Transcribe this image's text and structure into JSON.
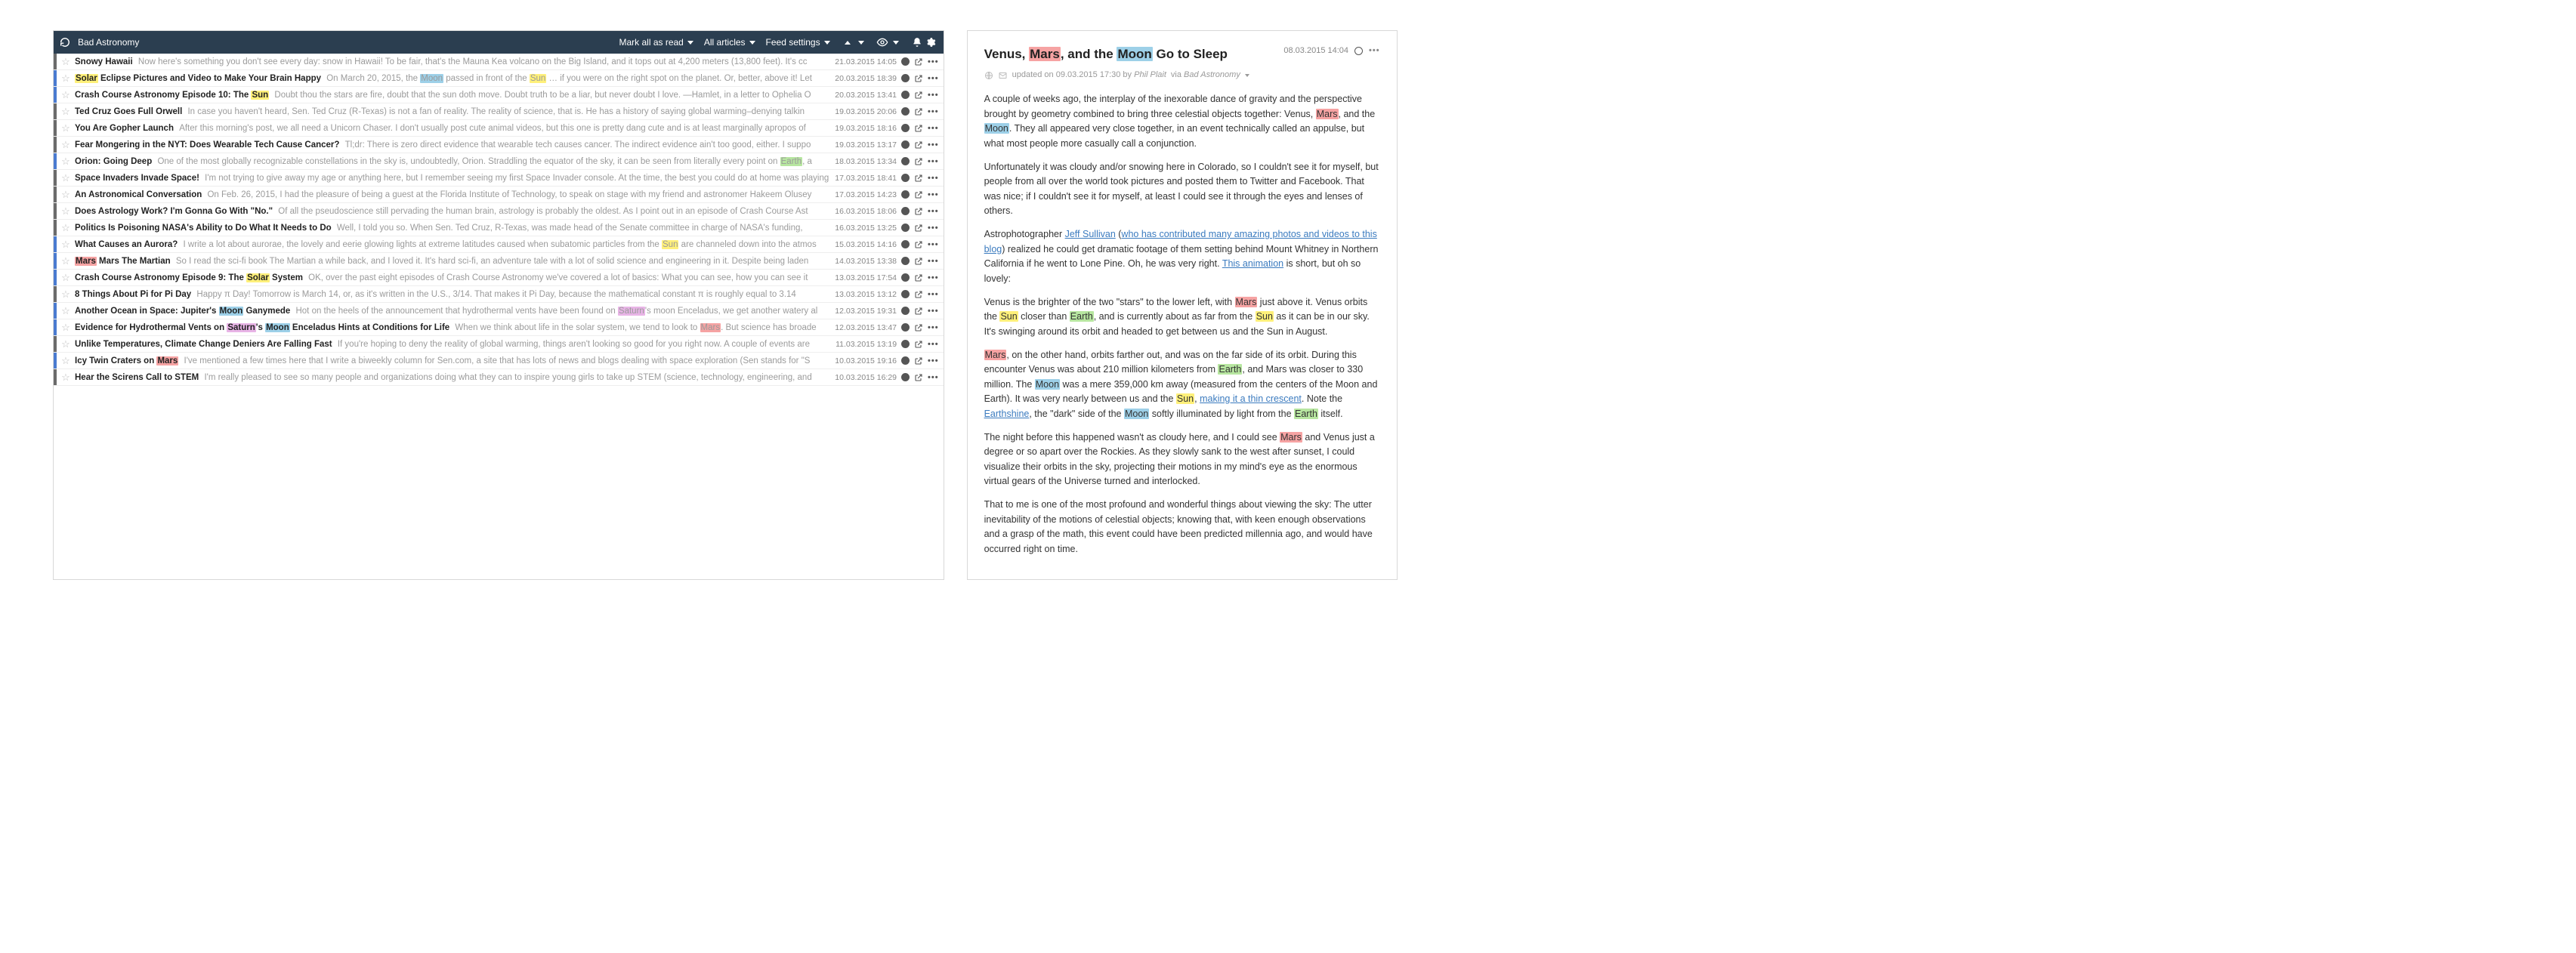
{
  "colors": {
    "accent_default": "#6b6b6b",
    "accent_active": "#4a7bd0",
    "mars": "#f6a3a3",
    "moon": "#9dd0e8",
    "sun": "#fff07a",
    "earth": "#b7e6a0",
    "saturn": "#e8b4e6"
  },
  "topbar": {
    "feed_title": "Bad Astronomy",
    "mark_all": "Mark all as read",
    "all_articles": "All articles",
    "feed_settings": "Feed settings"
  },
  "articles": [
    {
      "accent": "default",
      "unread": true,
      "title_segments": [
        {
          "t": "Snowy Hawaii"
        }
      ],
      "snippet": "Now here's something you don't see every day: snow in Hawaii! To be fair, that's the Mauna Kea volcano on the Big Island, and it tops out at 4,200 meters (13,800 feet). It's cc",
      "date": "21.03.2015 14:05"
    },
    {
      "accent": "active",
      "unread": true,
      "title_segments": [
        {
          "t": "Solar",
          "hl": "solar"
        },
        {
          "t": " Eclipse Pictures and Video to Make Your Brain Happy"
        }
      ],
      "snippet_segments": [
        {
          "t": "On March 20, 2015, the "
        },
        {
          "t": "Moon",
          "hl": "moon"
        },
        {
          "t": " passed in front of the "
        },
        {
          "t": "Sun",
          "hl": "sun"
        },
        {
          "t": " … if you were on the right spot on the planet. Or, better, above it! Let"
        }
      ],
      "date": "20.03.2015 18:39"
    },
    {
      "accent": "active",
      "unread": true,
      "title_segments": [
        {
          "t": "Crash Course Astronomy Episode 10: The "
        },
        {
          "t": "Sun",
          "hl": "sun"
        }
      ],
      "snippet": "Doubt thou the stars are fire, doubt that the sun doth move. Doubt truth to be a liar, but never doubt I love. —Hamlet, in a letter to Ophelia O",
      "date": "20.03.2015 13:41"
    },
    {
      "accent": "default",
      "unread": true,
      "title_segments": [
        {
          "t": "Ted Cruz Goes Full Orwell"
        }
      ],
      "snippet": "In case you haven't heard, Sen. Ted Cruz (R-Texas) is not a fan of reality. The reality of science, that is. He has a history of saying global warming–denying talkin",
      "date": "19.03.2015 20:06"
    },
    {
      "accent": "default",
      "unread": true,
      "title_segments": [
        {
          "t": "You Are Gopher Launch"
        }
      ],
      "snippet": "After this morning's post, we all need a Unicorn Chaser. I don't usually post cute animal videos, but this one is pretty dang cute and is at least marginally apropos of",
      "date": "19.03.2015 18:16"
    },
    {
      "accent": "default",
      "unread": true,
      "title_segments": [
        {
          "t": "Fear Mongering in the NYT: Does Wearable Tech Cause Cancer?"
        }
      ],
      "snippet": "Tl;dr: There is zero direct evidence that wearable tech causes cancer. The indirect evidence ain't too good, either. I suppo",
      "date": "19.03.2015 13:17"
    },
    {
      "accent": "active",
      "unread": true,
      "title_segments": [
        {
          "t": "Orion: Going Deep"
        }
      ],
      "snippet_segments": [
        {
          "t": "One of the most globally recognizable constellations in the sky is, undoubtedly, Orion. Straddling the equator of the sky, it can be seen from literally every point on "
        },
        {
          "t": "Earth",
          "hl": "earth"
        },
        {
          "t": ", a"
        }
      ],
      "date": "18.03.2015 13:34"
    },
    {
      "accent": "default",
      "unread": true,
      "title_segments": [
        {
          "t": "Space Invaders Invade Space!"
        }
      ],
      "snippet": "I'm not trying to give away my age or anything here, but I remember seeing my first Space Invader console. At the time, the best you could do at home was playing",
      "date": "17.03.2015 18:41"
    },
    {
      "accent": "default",
      "unread": true,
      "title_segments": [
        {
          "t": "An Astronomical Conversation"
        }
      ],
      "snippet": "On Feb. 26, 2015, I had the pleasure of being a guest at the Florida Institute of Technology, to speak on stage with my friend and astronomer Hakeem Olusey",
      "date": "17.03.2015 14:23"
    },
    {
      "accent": "default",
      "unread": true,
      "title_segments": [
        {
          "t": "Does Astrology Work? I'm Gonna Go With \"No.\""
        }
      ],
      "snippet": "Of all the pseudoscience still pervading the human brain, astrology is probably the oldest. As I point out in an episode of Crash Course Ast",
      "date": "16.03.2015 18:06"
    },
    {
      "accent": "default",
      "unread": true,
      "title_segments": [
        {
          "t": "Politics Is Poisoning NASA's Ability to Do What It Needs to Do"
        }
      ],
      "snippet": "Well, I told you so. When Sen. Ted Cruz, R-Texas, was made head of the Senate committee in charge of NASA's funding,",
      "date": "16.03.2015 13:25"
    },
    {
      "accent": "active",
      "unread": true,
      "title_segments": [
        {
          "t": "What Causes an Aurora?"
        }
      ],
      "snippet_segments": [
        {
          "t": "I write a lot about aurorae, the lovely and eerie glowing lights at extreme latitudes caused when subatomic particles from the "
        },
        {
          "t": "Sun",
          "hl": "sun"
        },
        {
          "t": " are channeled down into the atmos"
        }
      ],
      "date": "15.03.2015 14:16"
    },
    {
      "accent": "active",
      "unread": true,
      "title_segments": [
        {
          "t": "Mars",
          "hl": "mars"
        },
        {
          "t": " Mars The Martian"
        }
      ],
      "snippet": "So I read the sci-fi book The Martian a while back, and I loved it. It's hard sci-fi, an adventure tale with a lot of solid science and engineering in it. Despite being laden",
      "date": "14.03.2015 13:38"
    },
    {
      "accent": "active",
      "unread": true,
      "title_segments": [
        {
          "t": "Crash Course Astronomy Episode 9: The "
        },
        {
          "t": "Solar",
          "hl": "solar"
        },
        {
          "t": " System"
        }
      ],
      "snippet": "OK, over the past eight episodes of Crash Course Astronomy we've covered a lot of basics: What you can see, how you can see it",
      "date": "13.03.2015 17:54"
    },
    {
      "accent": "default",
      "unread": true,
      "title_segments": [
        {
          "t": "8 Things About Pi for Pi Day"
        }
      ],
      "snippet": "Happy π Day! Tomorrow is March 14, or, as it's written in the U.S., 3/14. That makes it Pi Day, because the mathematical constant π is roughly equal to 3.14",
      "date": "13.03.2015 13:12"
    },
    {
      "accent": "active",
      "unread": true,
      "title_segments": [
        {
          "t": "Another Ocean in Space: Jupiter's "
        },
        {
          "t": "Moon",
          "hl": "moon"
        },
        {
          "t": " Ganymede"
        }
      ],
      "snippet_segments": [
        {
          "t": "Hot on the heels of the announcement that hydrothermal vents have been found on "
        },
        {
          "t": "Saturn",
          "hl": "saturn"
        },
        {
          "t": "'s moon Enceladus, we get another watery al"
        }
      ],
      "date": "12.03.2015 19:31"
    },
    {
      "accent": "active",
      "unread": true,
      "title_segments": [
        {
          "t": "Evidence for Hydrothermal Vents on "
        },
        {
          "t": "Saturn",
          "hl": "saturn"
        },
        {
          "t": "'s "
        },
        {
          "t": "Moon",
          "hl": "moon"
        },
        {
          "t": " Enceladus Hints at Conditions for Life"
        }
      ],
      "snippet_segments": [
        {
          "t": "When we think about life in the solar system, we tend to look to "
        },
        {
          "t": "Mars",
          "hl": "mars"
        },
        {
          "t": ". But science has broade"
        }
      ],
      "date": "12.03.2015 13:47"
    },
    {
      "accent": "default",
      "unread": true,
      "title_segments": [
        {
          "t": "Unlike Temperatures, Climate Change Deniers Are Falling Fast"
        }
      ],
      "snippet": "If you're hoping to deny the reality of global warming, things aren't looking so good for you right now. A couple of events are",
      "date": "11.03.2015 13:19"
    },
    {
      "accent": "active",
      "unread": true,
      "title_segments": [
        {
          "t": "Icy Twin Craters on "
        },
        {
          "t": "Mars",
          "hl": "mars"
        }
      ],
      "snippet": "I've mentioned a few times here that I write a biweekly column for Sen.com, a site that has lots of news and blogs dealing with space exploration (Sen stands for \"S",
      "date": "10.03.2015 19:16"
    },
    {
      "accent": "default",
      "unread": true,
      "title_segments": [
        {
          "t": "Hear the Scirens Call to STEM"
        }
      ],
      "snippet": "I'm really pleased to see so many people and organizations doing what they can to inspire young girls to take up STEM (science, technology, engineering, and",
      "date": "10.03.2015 16:29"
    }
  ],
  "reader": {
    "title_segments": [
      {
        "t": "Venus, "
      },
      {
        "t": "Mars",
        "hl": "mars"
      },
      {
        "t": ", and the "
      },
      {
        "t": "Moon",
        "hl": "moon"
      },
      {
        "t": " Go to Sleep"
      }
    ],
    "date": "08.03.2015 14:04",
    "meta_line": {
      "updated_prefix": "updated on",
      "updated_value": "09.03.2015 17:30",
      "by": "by",
      "author": "Phil Plait",
      "via": "via",
      "source": "Bad Astronomy"
    },
    "paragraphs": [
      [
        {
          "t": "A couple of weeks ago, the interplay of the inexorable dance of gravity and the perspective brought by geometry combined to bring three celestial objects together: Venus, "
        },
        {
          "t": "Mars",
          "hl": "mars"
        },
        {
          "t": ", and the "
        },
        {
          "t": "Moon",
          "hl": "moon"
        },
        {
          "t": ". They all appeared very close together, in an event technically called an appulse, but what most people more casually call a conjunction."
        }
      ],
      [
        {
          "t": "Unfortunately it was cloudy and/or snowing here in Colorado, so I couldn't see it for myself, but people from all over the world took pictures and posted them to Twitter and Facebook. That was nice; if I couldn't see it for myself, at least I could see it through the eyes and lenses of others."
        }
      ],
      [
        {
          "t": "Astrophotographer "
        },
        {
          "t": "Jeff Sullivan",
          "link": true
        },
        {
          "t": " ("
        },
        {
          "t": "who has contributed many amazing photos and videos to this blog",
          "link": true
        },
        {
          "t": ") realized he could get dramatic footage of them setting behind Mount Whitney in Northern California if he went to Lone Pine. Oh, he was very right. "
        },
        {
          "t": "This animation",
          "link": true
        },
        {
          "t": " is short, but oh so lovely:"
        }
      ],
      [
        {
          "t": "Venus is the brighter of the two \"stars\" to the lower left, with "
        },
        {
          "t": "Mars",
          "hl": "mars"
        },
        {
          "t": " just above it. Venus orbits the "
        },
        {
          "t": "Sun",
          "hl": "sun"
        },
        {
          "t": " closer than "
        },
        {
          "t": "Earth",
          "hl": "earth"
        },
        {
          "t": ", and is currently about as far from the "
        },
        {
          "t": "Sun",
          "hl": "sun"
        },
        {
          "t": " as it can be in our sky. It's swinging around its orbit and headed to get between us and the Sun in August."
        }
      ],
      [
        {
          "t": "Mars",
          "hl": "mars"
        },
        {
          "t": ", on the other hand, orbits farther out, and was on the far side of its orbit. During this encounter Venus was about 210 million kilometers from "
        },
        {
          "t": "Earth",
          "hl": "earth"
        },
        {
          "t": ", and Mars was closer to 330 million. The "
        },
        {
          "t": "Moon",
          "hl": "moon"
        },
        {
          "t": " was a mere 359,000 km away (measured from the centers of the Moon and Earth). It was very nearly between us and the "
        },
        {
          "t": "Sun",
          "hl": "sun"
        },
        {
          "t": ", "
        },
        {
          "t": "making it a thin crescent",
          "link": true
        },
        {
          "t": ". Note the "
        },
        {
          "t": "Earthshine",
          "link": true
        },
        {
          "t": ", the \"dark\" side of the "
        },
        {
          "t": "Moon",
          "hl": "moon"
        },
        {
          "t": " softly illuminated by light from the "
        },
        {
          "t": "Earth",
          "hl": "earth"
        },
        {
          "t": " itself."
        }
      ],
      [
        {
          "t": "The night before this happened wasn't as cloudy here, and I could see "
        },
        {
          "t": "Mars",
          "hl": "mars"
        },
        {
          "t": " and Venus just a degree or so apart over the Rockies. As they slowly sank to the west after sunset, I could visualize their orbits in the sky, projecting their motions in my mind's eye as the enormous virtual gears of the Universe turned and interlocked."
        }
      ],
      [
        {
          "t": "That to me is one of the most profound and wonderful things about viewing the sky: The utter inevitability of the motions of celestial objects; knowing that, with keen enough observations and a grasp of the math, this event could have been predicted millennia ago, and would have occurred right on time."
        }
      ]
    ]
  }
}
